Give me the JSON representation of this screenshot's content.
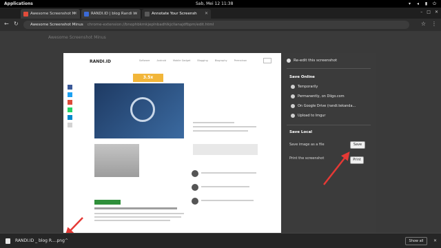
{
  "topbar": {
    "applications": "Applications",
    "clock": "Sab, Mei 12   11:38"
  },
  "tabs": [
    {
      "title": "Awesome Screenshot M",
      "favicon_color": "#e14c3b"
    },
    {
      "title": "RANDI.ID | blog Randi In",
      "favicon_color": "#3b6ad6"
    },
    {
      "title": "Annotate Your Screensh",
      "favicon_color": "#5a5a5a"
    }
  ],
  "address": {
    "prefix": "Awesome Screenshot Minus",
    "url": "chrome-extension://bnophbkmkjeplnbadhlkjcllanajdfbpm/edit.html"
  },
  "page": {
    "background_title": "Awesome Screenshot Minus"
  },
  "preview": {
    "logo": "RANDI.ID",
    "nav": [
      "Software",
      "Android",
      "Mobile Gadget",
      "Blogging",
      "Biography",
      "Permainan"
    ],
    "banner": "3.5x",
    "share_colors": [
      "#3b5998",
      "#1da1f2",
      "#dd4b39",
      "#25d366",
      "#0088cc",
      "#d3d3d3"
    ]
  },
  "panel": {
    "re_edit": "Re-edit this screenshot",
    "save_online": "Save Online",
    "online_items": [
      "Temporarily",
      "Permanently, on Diigo.com",
      "On Google Drive (randi.tekanda...",
      "Upload to Imgur"
    ],
    "save_local": "Save Local",
    "save_as_file": "Save image as a file",
    "save_button": "Save",
    "print_label": "Print the screenshot",
    "print_button": "Print"
  },
  "downloads": {
    "file_name": "RANDI.ID _ blog R....png",
    "show_all": "Show all"
  },
  "colors": {
    "arrow": "#e53935",
    "panel": "#3b3b3b",
    "top_bar": "#000000"
  }
}
